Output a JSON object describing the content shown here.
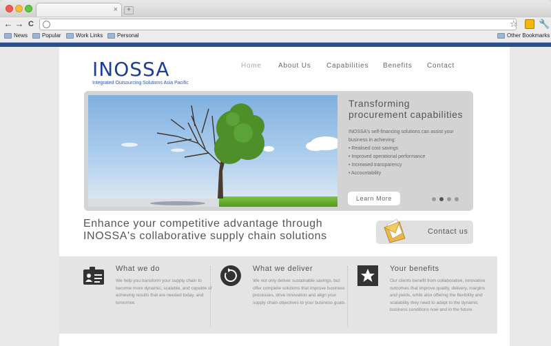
{
  "browser": {
    "tab_close": "×",
    "new_tab": "+",
    "nav": {
      "back": "←",
      "forward": "→",
      "reload": "C"
    },
    "star": "☆",
    "wrench": "🔧",
    "bookmarks": [
      "News",
      "Popular",
      "Work Links",
      "Personal"
    ],
    "other_bookmarks": "Other Bookmarks",
    "accent_color": "#2d4d93"
  },
  "site": {
    "logo": "INOSSA",
    "tagline": "Integrated Outsourcing Solutions Asia Pacific",
    "brand_color": "#1c3f95",
    "nav": [
      "Home",
      "About Us",
      "Capabilities",
      "Benefits",
      "Contact"
    ]
  },
  "hero": {
    "title": "Transforming procurement capabilities",
    "intro": "INOSSA's self-financing solutions can assist your business in achieving:",
    "bullets": [
      "• Realised cost savings",
      "• Improved operational performance",
      "• Increased transparency",
      "• Accountability"
    ],
    "button": "Learn More",
    "slides_total": 4,
    "active_slide": 2
  },
  "headline": {
    "line1": "Enhance your competitive advantage through",
    "line2": "INOSSA's collaborative supply chain solutions"
  },
  "contact": {
    "label": "Contact us"
  },
  "features": [
    {
      "title": "What we do",
      "icon": "id-card-icon",
      "text": "We help you transform your supply chain to become more dynamic, scalable, and capable of achieving results that are needed today, and tomorrow."
    },
    {
      "title": "What we deliver",
      "icon": "refresh-circle-icon",
      "text": "We not only deliver sustainable savings, but offer complete solutions that improve business processes, drive innovation and align your supply chain objectives to your business goals."
    },
    {
      "title": "Your benefits",
      "icon": "star-badge-icon",
      "text": "Our clients benefit from collaborative, innovative outcomes that improve quality, delivery, margins and yields, while also offering the flexibility and scalability they need to adapt to the dynamic business conditions now and in the future."
    }
  ]
}
